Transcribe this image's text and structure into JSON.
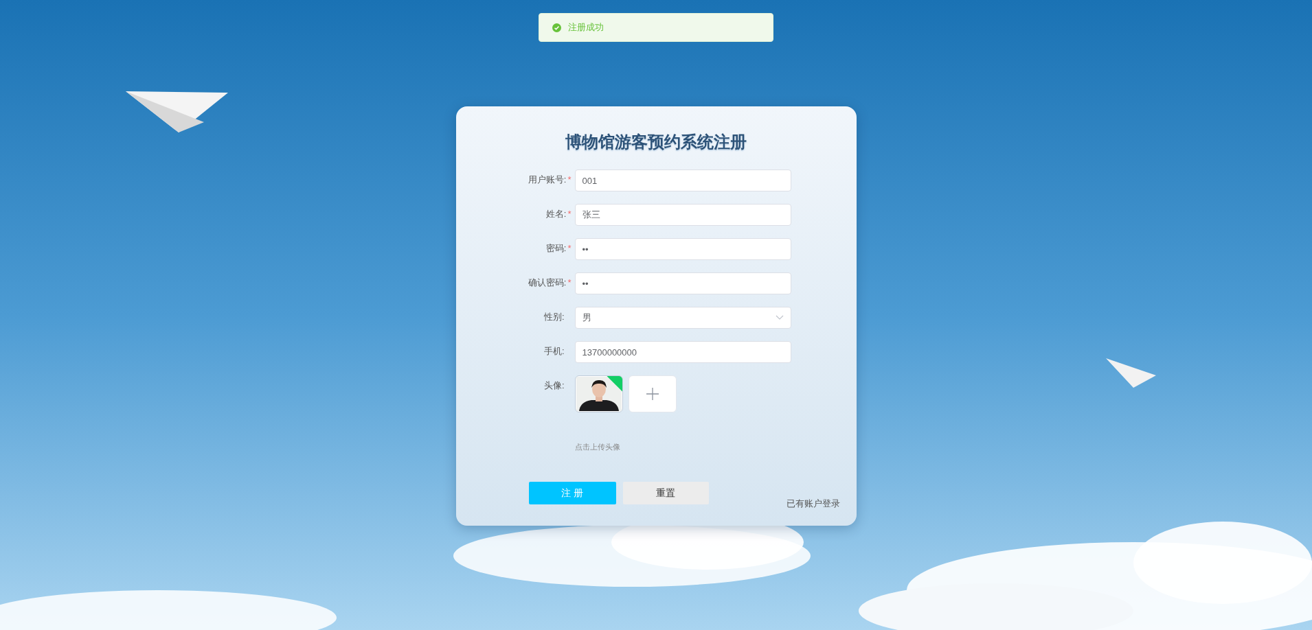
{
  "toast": {
    "kind": "success",
    "message": "注册成功"
  },
  "form": {
    "title": "博物馆游客预约系统注册",
    "fields": [
      {
        "kind": "input",
        "label": "用户账号:",
        "required_mark": "*",
        "value": "001"
      },
      {
        "kind": "input",
        "label": "姓名:",
        "required_mark": "*",
        "value": "张三"
      },
      {
        "kind": "input",
        "label": "密码:",
        "required_mark": "*",
        "value": "••"
      },
      {
        "kind": "input",
        "label": "确认密码:",
        "required_mark": "*",
        "value": "••"
      },
      {
        "kind": "select",
        "label": "性别:",
        "value": "男"
      },
      {
        "kind": "input",
        "label": "手机:",
        "value": "13700000000"
      },
      {
        "kind": "upload",
        "label": "头像:",
        "uploaded": true,
        "hint": "点击上传头像"
      }
    ],
    "buttons": [
      {
        "kind": "primary",
        "label": "注 册"
      },
      {
        "kind": "secondary",
        "label": "重置"
      }
    ],
    "login_link": "已有账户登录"
  }
}
